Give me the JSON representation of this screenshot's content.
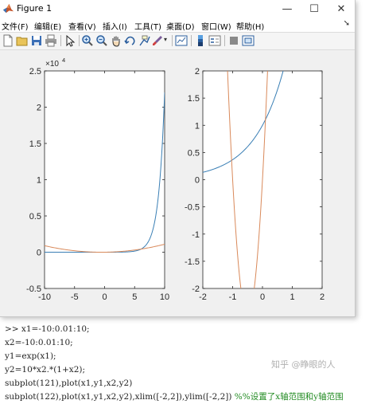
{
  "window": {
    "title": "Figure 1",
    "controls": {
      "minimize": "—",
      "maximize": "☐",
      "close": "✕"
    }
  },
  "menu": {
    "items": [
      "文件(F)",
      "编辑(E)",
      "查看(V)",
      "插入(I)",
      "工具(T)",
      "桌面(D)",
      "窗口(W)",
      "帮助(H)"
    ],
    "overflow_arrow": "➘"
  },
  "toolbar": {
    "icons": [
      "new-figure-icon",
      "open-icon",
      "save-icon",
      "print-icon",
      "select-arrow-icon",
      "zoom-in-icon",
      "zoom-out-icon",
      "pan-hand-icon",
      "rotate-3d-icon",
      "data-cursor-icon",
      "brush-icon",
      "link-plot-icon",
      "insert-colorbar-icon",
      "insert-legend-icon",
      "hide-plot-tools-icon",
      "show-plot-tools-icon"
    ]
  },
  "colors": {
    "series1": "#3a7fb5",
    "series2": "#d9895a"
  },
  "chart_data": [
    {
      "type": "line",
      "title": "",
      "xlabel": "",
      "ylabel": "",
      "exponent_label": "×10",
      "exponent_power": "4",
      "xlim": [
        -10,
        10
      ],
      "ylim": [
        -0.5,
        2.5
      ],
      "y_scale_factor": 10000,
      "xticks": [
        "-10",
        "-5",
        "0",
        "5",
        "10"
      ],
      "yticks": [
        "-0.5",
        "0",
        "0.5",
        "1",
        "1.5",
        "2",
        "2.5"
      ],
      "x": [
        -10,
        -8,
        -6,
        -4,
        -2,
        0,
        2,
        4,
        5,
        6,
        7,
        8,
        8.5,
        9,
        9.5,
        10
      ],
      "series": [
        {
          "values": [
            0.0,
            0.0003,
            0.0025,
            0.0183,
            0.1353,
            1,
            7.39,
            54.6,
            148.4,
            403.4,
            1096.6,
            2981,
            4915,
            8103,
            13360,
            22026
          ]
        },
        {
          "values": [
            900,
            448,
            180,
            48,
            -8,
            0,
            24,
            160,
            250,
            360,
            490,
            640,
            722.5,
            810,
            902.5,
            1000
          ]
        }
      ]
    },
    {
      "type": "line",
      "title": "",
      "xlabel": "",
      "ylabel": "",
      "xlim": [
        -2,
        2
      ],
      "ylim": [
        -2,
        2
      ],
      "xticks": [
        "-2",
        "-1",
        "0",
        "1",
        "2"
      ],
      "yticks": [
        "-2",
        "-1.5",
        "-1",
        "-0.5",
        "0",
        "0.5",
        "1",
        "1.5",
        "2"
      ],
      "x": [
        -2,
        -1.5,
        -1.2,
        -1,
        -0.8,
        -0.6,
        -0.5,
        -0.4,
        -0.2,
        -0.1,
        0,
        0.1,
        0.2,
        0.4,
        0.6,
        0.693
      ],
      "series": [
        {
          "values": [
            0.135,
            0.223,
            0.301,
            0.368,
            0.449,
            0.549,
            0.607,
            0.67,
            0.819,
            0.905,
            1.0,
            1.105,
            1.221,
            1.492,
            1.822,
            2.0
          ]
        },
        {
          "values": [
            20,
            7.5,
            2.4,
            0,
            -1.6,
            -2.4,
            -2.5,
            -2.4,
            -1.6,
            -0.9,
            0,
            1.1,
            2.4,
            5.6,
            9.6,
            11.7
          ]
        }
      ]
    }
  ],
  "console": {
    "lines": [
      {
        "code": ">> x1=-10:0.01:10;",
        "comment": ""
      },
      {
        "code": "x2=-10:0.01:10;",
        "comment": ""
      },
      {
        "code": "y1=exp(x1);",
        "comment": ""
      },
      {
        "code": "y2=10*x2.*(1+x2);",
        "comment": ""
      },
      {
        "code": "subplot(121),plot(x1,y1,x2,y2)",
        "comment": ""
      },
      {
        "code": "subplot(122),plot(x1,y1,x2,y2),xlim([-2,2]),ylim([-2,2])",
        "comment": " %%设置了x轴范围和y轴范围"
      }
    ]
  },
  "watermark": "知乎 @睁眼的人"
}
